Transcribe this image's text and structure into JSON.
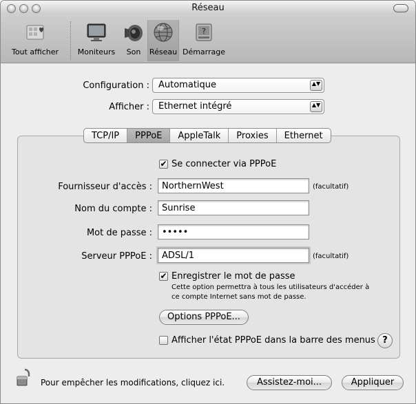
{
  "window": {
    "title": "Réseau"
  },
  "toolbar": {
    "items": [
      {
        "label": "Tout afficher",
        "icon": "show-all-icon"
      },
      {
        "label": "Moniteurs",
        "icon": "monitor-icon"
      },
      {
        "label": "Son",
        "icon": "speaker-icon"
      },
      {
        "label": "Réseau",
        "icon": "network-globe-icon",
        "selected": true
      },
      {
        "label": "Démarrage",
        "icon": "startup-disk-icon"
      }
    ]
  },
  "config": {
    "configuration_label": "Configuration :",
    "configuration_value": "Automatique",
    "afficher_label": "Afficher :",
    "afficher_value": "Ethernet intégré"
  },
  "tabs": [
    "TCP/IP",
    "PPPoE",
    "AppleTalk",
    "Proxies",
    "Ethernet"
  ],
  "active_tab": "PPPoE",
  "pppoe": {
    "connect_label": "Se connecter via PPPoE",
    "connect_checked": true,
    "provider_label": "Fournisseur d'accès :",
    "provider_value": "NorthernWest",
    "provider_hint": "(facultatif)",
    "account_label": "Nom du compte :",
    "account_value": "Sunrise",
    "password_label": "Mot de passe :",
    "password_value": "•••••",
    "server_label": "Serveur PPPoE :",
    "server_value": "ADSL/1",
    "server_hint": "(facultatif)",
    "save_password_label": "Enregistrer le mot de passe",
    "save_password_checked": true,
    "save_password_note_1": "Cette option permettra à tous les utilisateurs d'accéder à",
    "save_password_note_2": "ce compte Internet sans mot de passe.",
    "options_button": "Options PPPoE...",
    "show_status_label": "Afficher l'état PPPoE dans la barre des menus",
    "show_status_checked": false,
    "help_label": "?"
  },
  "footer": {
    "lock_text": "Pour empêcher les modifications, cliquez ici.",
    "assist_button": "Assistez-moi...",
    "apply_button": "Appliquer"
  },
  "check_mark": "✔",
  "popup_arrows": "▲▼"
}
